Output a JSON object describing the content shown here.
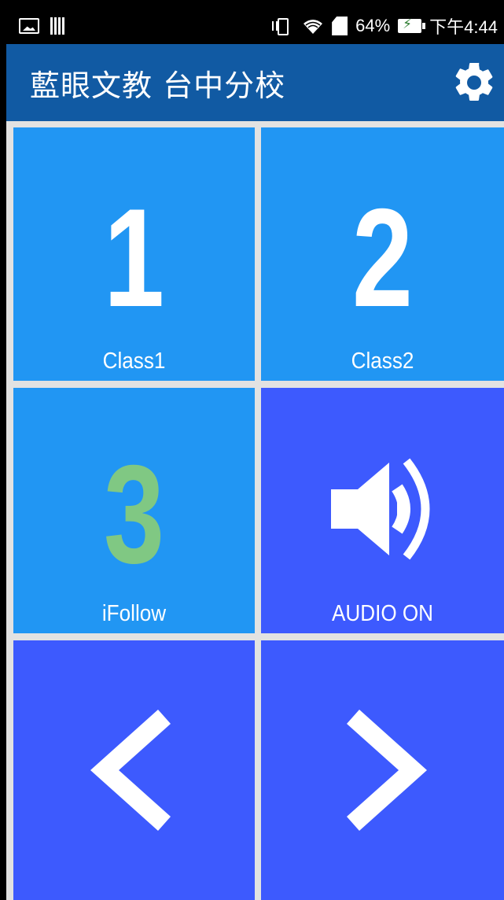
{
  "status_bar": {
    "left_icons": [
      "image-icon",
      "barcode-icon"
    ],
    "right_icons": [
      "vibrate-icon",
      "wifi-icon",
      "sd-card-icon"
    ],
    "battery_percent": "64%",
    "battery_icon": "battery-charging-icon",
    "time": "下午4:44"
  },
  "app_bar": {
    "title": "藍眼文教 台中分校",
    "settings_icon": "gear-icon",
    "color": "#115aa3"
  },
  "tiles": [
    {
      "number": "1",
      "label": "Class1",
      "color": "#2196f3",
      "number_color": "#ffffff"
    },
    {
      "number": "2",
      "label": "Class2",
      "color": "#2196f3",
      "number_color": "#ffffff"
    },
    {
      "number": "3",
      "label": "iFollow",
      "color": "#2196f3",
      "number_color": "#80c883"
    },
    {
      "icon": "speaker-volume-icon",
      "label": "AUDIO ON",
      "color": "#3d5afe"
    },
    {
      "icon": "chevron-left-icon",
      "label": "",
      "color": "#3d5afe"
    },
    {
      "icon": "chevron-right-icon",
      "label": "",
      "color": "#3d5afe"
    }
  ]
}
